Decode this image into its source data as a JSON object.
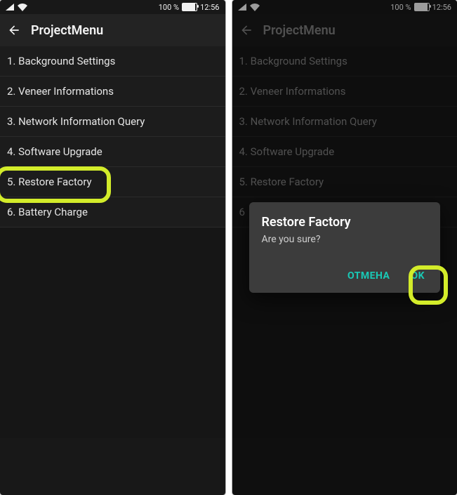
{
  "status": {
    "battery_pct": "100 %",
    "time": "12:56"
  },
  "app": {
    "title": "ProjectMenu"
  },
  "menu": {
    "items": [
      "1. Background Settings",
      "2. Veneer Informations",
      "3. Network Information Query",
      "4. Software Upgrade",
      "5. Restore Factory",
      "6. Battery Charge"
    ],
    "truncated_item6": "6"
  },
  "dialog": {
    "title": "Restore Factory",
    "message": "Are you sure?",
    "cancel": "ОТМЕНА",
    "ok": "OK"
  },
  "colors": {
    "highlight": "#d3ec2a",
    "action_text": "#19c9b6",
    "bg": "#181818"
  }
}
